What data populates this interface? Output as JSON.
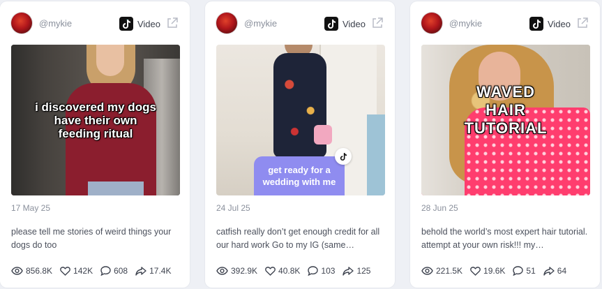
{
  "cards": [
    {
      "handle": "@mykie",
      "platform": "Video",
      "overlay_text": "i discovered my dogs\nhave their own\nfeeding ritual",
      "date": "17 May 25",
      "caption": "please tell me stories of weird things your dogs do too",
      "stats": {
        "views": "856.8K",
        "likes": "142K",
        "comments": "608",
        "shares": "17.4K"
      }
    },
    {
      "handle": "@mykie",
      "platform": "Video",
      "overlay_text": "get ready for a\nwedding with me",
      "date": "24 Jul 25",
      "caption": "catfish really don’t get enough credit for all our hard work Go to my IG (same…",
      "stats": {
        "views": "392.9K",
        "likes": "40.8K",
        "comments": "103",
        "shares": "125"
      }
    },
    {
      "handle": "@mykie",
      "platform": "Video",
      "overlay_text": "WAVED\nHAIR\nTUTORIAL",
      "date": "28 Jun 25",
      "caption": "behold the world’s most expert hair tutorial. attempt at your own risk!!! my…",
      "stats": {
        "views": "221.5K",
        "likes": "19.6K",
        "comments": "51",
        "shares": "64"
      }
    }
  ],
  "icons": {
    "platform": "tiktok-logo-icon",
    "open_external": "external-link-icon",
    "views": "eye-icon",
    "likes": "heart-icon",
    "comments": "comment-bubble-icon",
    "shares": "share-arrow-icon"
  },
  "colors": {
    "background": "#eef0f5",
    "card": "#ffffff",
    "muted_text": "#8a909c",
    "bubble": "#8f8cf0",
    "tiktok_black": "#111111"
  }
}
